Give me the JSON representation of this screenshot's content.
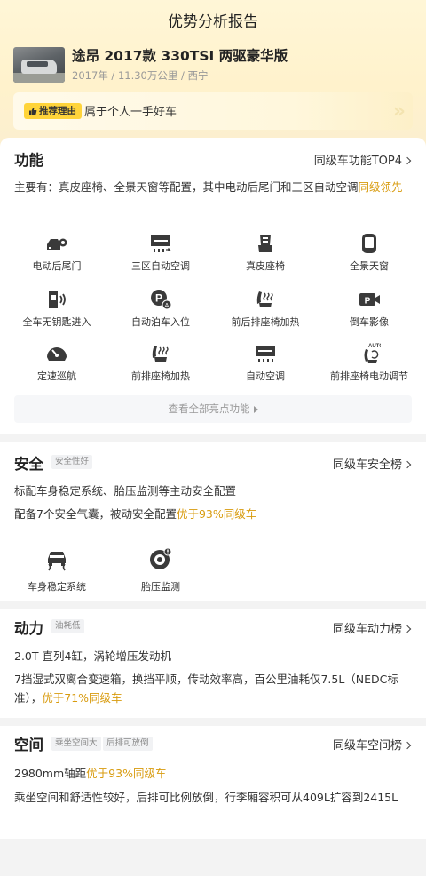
{
  "header": {
    "title": "优势分析报告"
  },
  "car": {
    "name": "途昂 2017款 330TSI 两驱豪华版",
    "meta": "2017年 / 11.30万公里 / 西宁"
  },
  "reason": {
    "badge": "推荐理由",
    "text": "属于个人一手好车"
  },
  "function": {
    "title": "功能",
    "link": "同级车功能TOP4",
    "desc_prefix": "主要有：真皮座椅、全景天窗等配置，其中电动后尾门和三区自动空调",
    "desc_highlight": "同级领先",
    "features": [
      {
        "label": "电动后尾门",
        "icon": "power-tailgate-icon"
      },
      {
        "label": "三区自动空调",
        "icon": "auto-ac-icon"
      },
      {
        "label": "真皮座椅",
        "icon": "leather-seat-icon"
      },
      {
        "label": "全景天窗",
        "icon": "panoramic-sunroof-icon"
      },
      {
        "label": "全车无钥匙进入",
        "icon": "keyless-entry-icon"
      },
      {
        "label": "自动泊车入位",
        "icon": "auto-parking-icon"
      },
      {
        "label": "前后排座椅加热",
        "icon": "seat-heating-icon"
      },
      {
        "label": "倒车影像",
        "icon": "reverse-camera-icon"
      },
      {
        "label": "定速巡航",
        "icon": "cruise-control-icon"
      },
      {
        "label": "前排座椅加热",
        "icon": "front-seat-heating-icon"
      },
      {
        "label": "自动空调",
        "icon": "auto-ac-icon"
      },
      {
        "label": "前排座椅电动调节",
        "icon": "power-seat-icon"
      }
    ],
    "view_all": "查看全部亮点功能"
  },
  "safety": {
    "title": "安全",
    "tag": "安全性好",
    "link": "同级车安全榜",
    "line1": "标配车身稳定系统、胎压监测等主动安全配置",
    "line2_prefix": "配备7个安全气囊，被动安全配置",
    "line2_highlight": "优于93%同级车",
    "features": [
      {
        "label": "车身稳定系统",
        "icon": "stability-control-icon"
      },
      {
        "label": "胎压监测",
        "icon": "tire-pressure-icon"
      }
    ]
  },
  "power": {
    "title": "动力",
    "tag": "油耗低",
    "link": "同级车动力榜",
    "line1": "2.0T 直列4缸，涡轮增压发动机",
    "line2_prefix": "7挡湿式双离合变速箱，换挡平顺，传动效率高，百公里油耗仅7.5L（NEDC标准），",
    "line2_highlight": "优于71%同级车"
  },
  "space": {
    "title": "空间",
    "tags": [
      "乘坐空间大",
      "后排可放倒"
    ],
    "link": "同级车空间榜",
    "line1_prefix": "2980mm轴距",
    "line1_highlight": "优于93%同级车",
    "line2": "乘坐空间和舒适性较好，后排可比例放倒，行李厢容积可从409L扩容到2415L"
  },
  "colors": {
    "accent": "#d89b0e",
    "badge": "#ffd43a",
    "icon": "#3a3a3a"
  }
}
